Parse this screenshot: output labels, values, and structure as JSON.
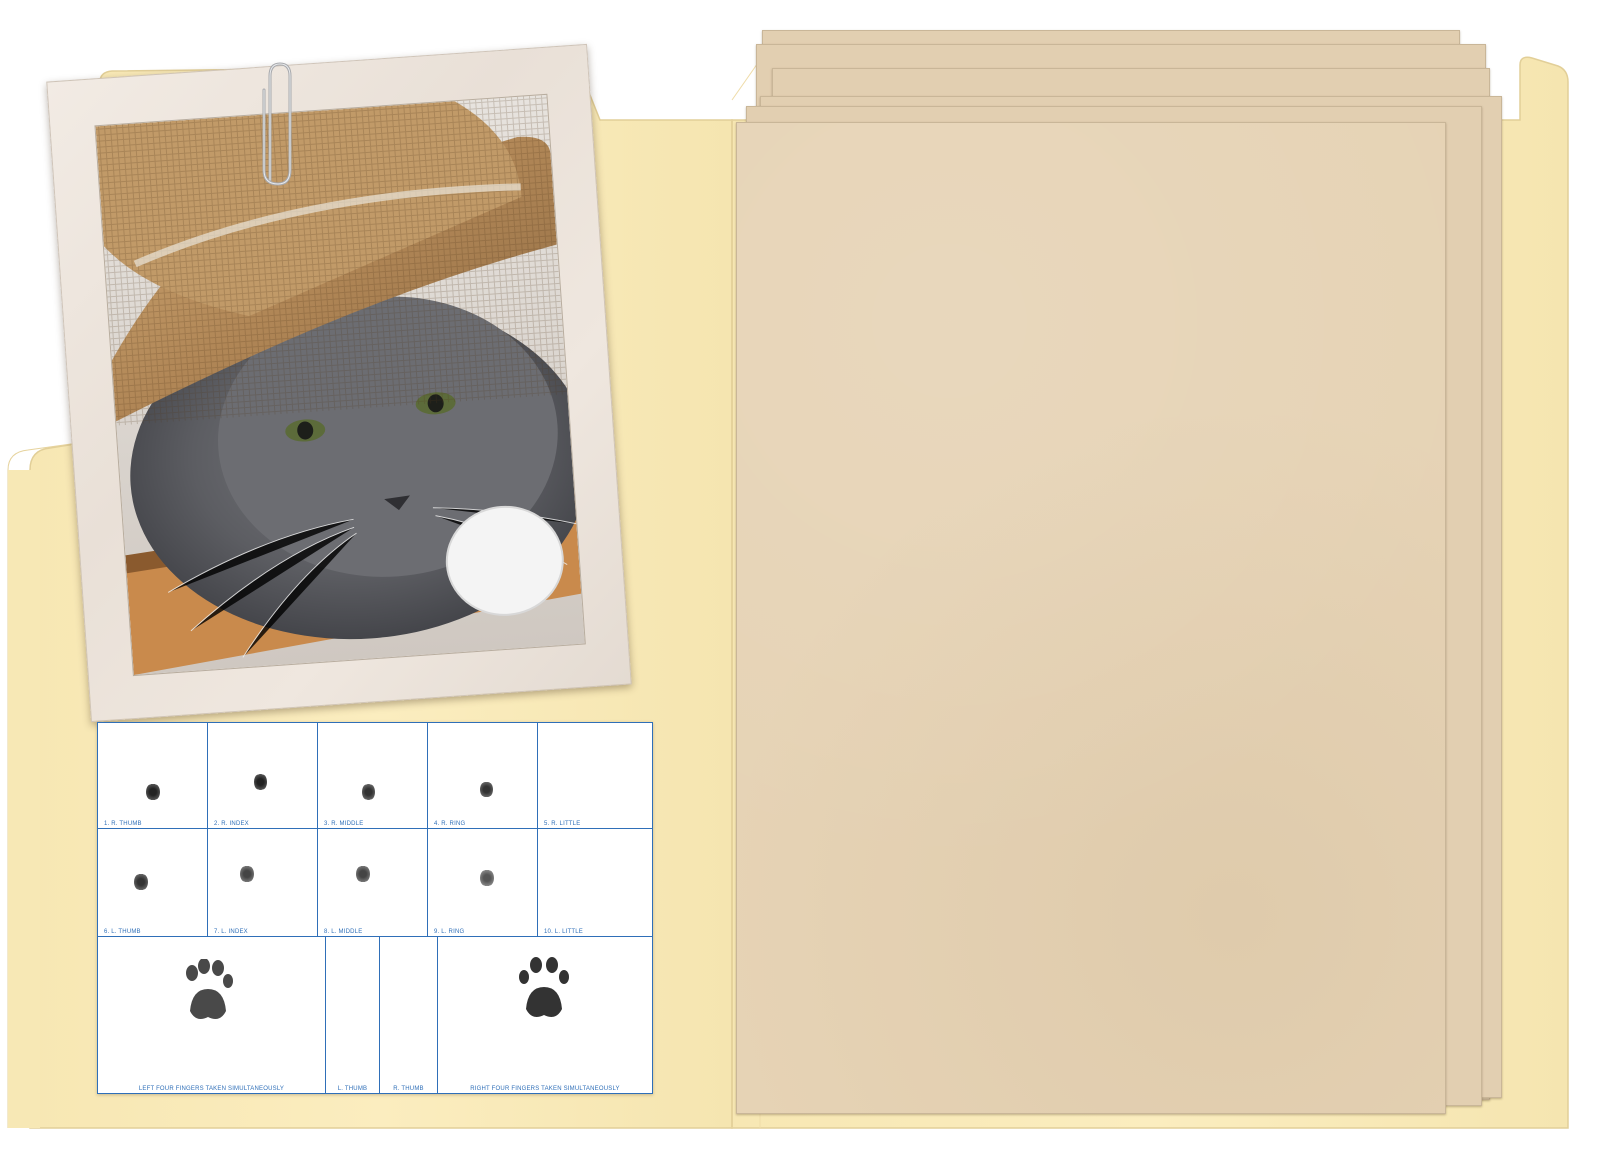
{
  "fingerprint_card": {
    "row1": [
      "1. R. THUMB",
      "2. R. INDEX",
      "3. R. MIDDLE",
      "4. R. RING",
      "5. R. LITTLE"
    ],
    "row2": [
      "6. L. THUMB",
      "7. L. INDEX",
      "8. L. MIDDLE",
      "9. L. RING",
      "10. L. LITTLE"
    ],
    "row3": {
      "left": "LEFT FOUR FINGERS TAKEN SIMULTANEOUSLY",
      "l_thumb": "L. THUMB",
      "r_thumb": "R. THUMB",
      "right": "RIGHT FOUR FINGERS TAKEN SIMULTANEOUSLY"
    }
  },
  "colors": {
    "folder": "#fbedbd",
    "paper": "#e6d3b5",
    "card_ink": "#2f6fb8"
  }
}
